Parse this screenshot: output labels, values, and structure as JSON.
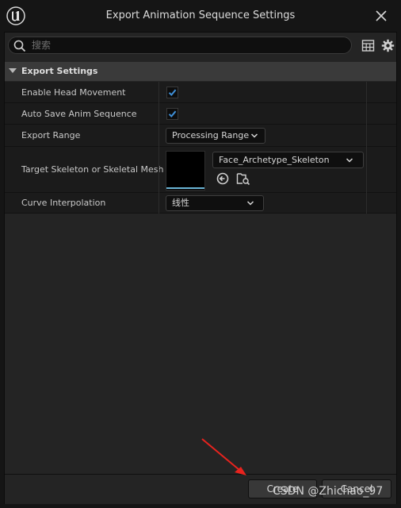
{
  "window": {
    "title": "Export Animation Sequence Settings"
  },
  "search": {
    "placeholder": "搜索",
    "value": ""
  },
  "category": {
    "title": "Export Settings"
  },
  "rows": {
    "enable_head_movement": {
      "label": "Enable Head Movement",
      "checked": true
    },
    "auto_save": {
      "label": "Auto Save Anim Sequence",
      "checked": true
    },
    "export_range": {
      "label": "Export Range",
      "value": "Processing Range"
    },
    "target_skeleton": {
      "label": "Target Skeleton or Skeletal Mesh",
      "value": "Face_Archetype_Skeleton"
    },
    "curve_interpolation": {
      "label": "Curve Interpolation",
      "value": "线性"
    }
  },
  "buttons": {
    "create": "Create",
    "cancel": "Cancel"
  },
  "watermark": "CSDN @Zhichao_97",
  "icons": [
    "ue-logo-icon",
    "close-icon",
    "search-icon",
    "table-view-icon",
    "settings-icon",
    "expand-arrow-icon",
    "checkmark-icon",
    "chevron-down-icon",
    "browse-to-asset-icon",
    "find-in-content-browser-icon"
  ],
  "colors": {
    "accent": "#3f8fd6",
    "thumbnail_bar": "#6bb5d6",
    "annotation_arrow": "#e8231e"
  }
}
